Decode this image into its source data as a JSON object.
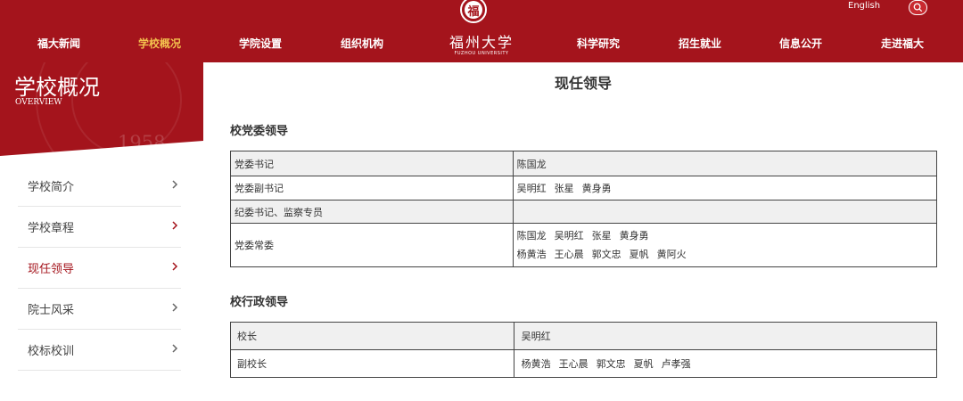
{
  "header": {
    "lang": "English",
    "nav": [
      {
        "label": "福大新闻",
        "active": false
      },
      {
        "label": "学校概况",
        "active": true
      },
      {
        "label": "学院设置",
        "active": false
      },
      {
        "label": "组织机构",
        "active": false
      },
      {
        "label": "科学研究",
        "active": false
      },
      {
        "label": "招生就业",
        "active": false
      },
      {
        "label": "信息公开",
        "active": false
      },
      {
        "label": "走进福大",
        "active": false
      }
    ],
    "logo": {
      "seal": "福",
      "cn": "福州大学",
      "en": "FUZHOU UNIVERSITY"
    }
  },
  "sidebar": {
    "title": "学校概况",
    "subtitle": "OVERVIEW",
    "bg_year": "1958",
    "items": [
      {
        "label": "学校简介"
      },
      {
        "label": "学校章程"
      },
      {
        "label": "现任领导"
      },
      {
        "label": "院士风采"
      },
      {
        "label": "校标校训"
      }
    ]
  },
  "main": {
    "title": "现任领导",
    "party": {
      "heading": "校党委领导",
      "rows": [
        {
          "role": "党委书记",
          "names": [
            "陈国龙"
          ]
        },
        {
          "role": "党委副书记",
          "names": [
            "吴明红",
            "张星",
            "黄身勇"
          ]
        },
        {
          "role": "纪委书记、监察专员",
          "names": []
        },
        {
          "role": "党委常委",
          "names": [
            "陈国龙",
            "吴明红",
            "张星",
            "黄身勇"
          ],
          "names2": [
            "杨黄浩",
            "王心晨",
            "郭文忠",
            "夏帆",
            "黄阿火"
          ]
        }
      ]
    },
    "admin": {
      "heading": "校行政领导",
      "rows": [
        {
          "role": "校长",
          "names": [
            "吴明红"
          ]
        },
        {
          "role": "副校长",
          "names": [
            "杨黄浩",
            "王心晨",
            "郭文忠",
            "夏帆",
            "卢孝强"
          ]
        }
      ]
    }
  },
  "colors": {
    "brand": "#a4141c",
    "active_nav": "#f3c14e"
  }
}
